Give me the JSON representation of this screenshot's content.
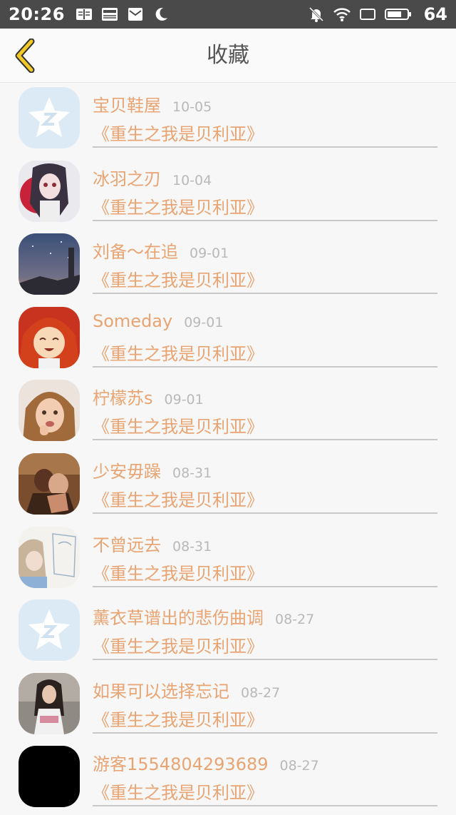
{
  "status_bar": {
    "time": "20:26",
    "battery": "64",
    "left_icons": [
      "reader-icon",
      "news-icon",
      "mail-icon",
      "moon-icon"
    ],
    "right_icons": [
      "mute-bell-icon",
      "wifi-icon",
      "screen-icon",
      "battery-icon"
    ]
  },
  "header": {
    "title": "收藏",
    "back_icon": "chevron-left-icon",
    "accent_color": "#f2c829"
  },
  "colors": {
    "name_text": "#e8a472",
    "date_text": "#b9b9b9",
    "background": "#f7f7f7"
  },
  "items": [
    {
      "name": "宝贝鞋屋",
      "date": "10-05",
      "book": "《重生之我是贝利亚》",
      "avatar": "default-star-avatar"
    },
    {
      "name": "冰羽之刃",
      "date": "10-04",
      "book": "《重生之我是贝利亚》",
      "avatar": "anime-girl-red-avatar"
    },
    {
      "name": "刘备～在追",
      "date": "09-01",
      "book": "《重生之我是贝利亚》",
      "avatar": "night-sky-avatar"
    },
    {
      "name": "Someday",
      "date": "09-01",
      "book": "《重生之我是贝利亚》",
      "avatar": "red-hair-anime-avatar"
    },
    {
      "name": "柠檬苏s",
      "date": "09-01",
      "book": "《重生之我是贝利亚》",
      "avatar": "child-photo-avatar"
    },
    {
      "name": "少安毋躁",
      "date": "08-31",
      "book": "《重生之我是贝利亚》",
      "avatar": "couple-photo-avatar"
    },
    {
      "name": "不曾远去",
      "date": "08-31",
      "book": "《重生之我是贝利亚》",
      "avatar": "anime-sketch-avatar"
    },
    {
      "name": "薰衣草谱出的悲伤曲调",
      "date": "08-27",
      "book": "《重生之我是贝利亚》",
      "avatar": "default-star-avatar"
    },
    {
      "name": "如果可以选择忘记",
      "date": "08-27",
      "book": "《重生之我是贝利亚》",
      "avatar": "girl-photo-avatar"
    },
    {
      "name": "游客1554804293689",
      "date": "08-27",
      "book": "《重生之我是贝利亚》",
      "avatar": "black-avatar"
    }
  ]
}
